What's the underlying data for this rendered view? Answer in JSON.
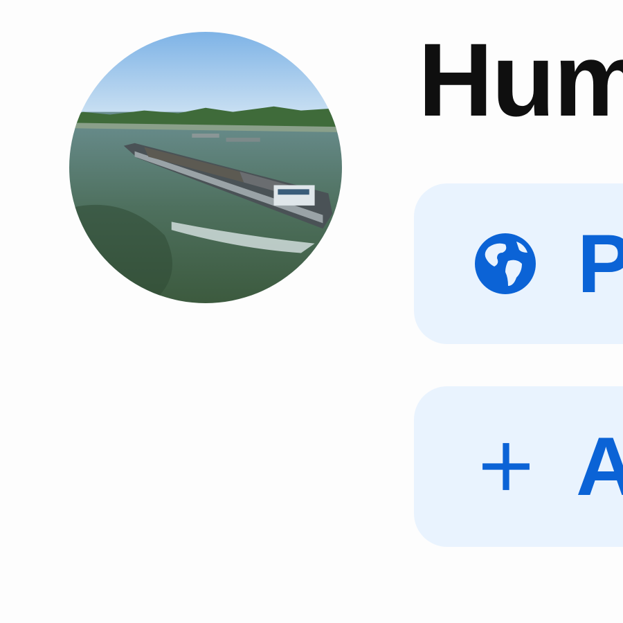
{
  "channel": {
    "name": "Hum",
    "avatar": {
      "alt": "avatar-photo"
    }
  },
  "chips": [
    {
      "icon": "globe-icon",
      "label": "P"
    },
    {
      "icon": "plus-icon",
      "label": "A"
    }
  ],
  "colors": {
    "accent": "#0b63d6",
    "chip_background": "#e9f3fe",
    "title": "#0f0f0f"
  }
}
